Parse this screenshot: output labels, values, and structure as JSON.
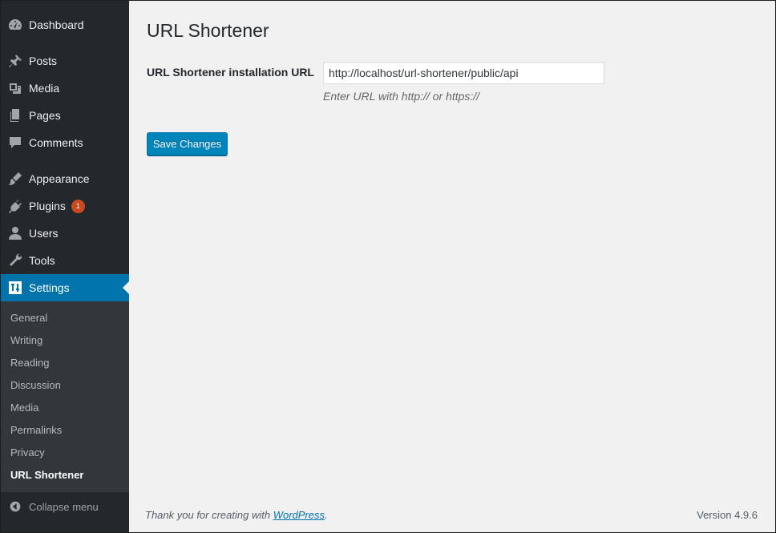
{
  "sidebar": {
    "items": [
      {
        "label": "Dashboard",
        "icon": "dashboard-icon"
      },
      {
        "label": "Posts",
        "icon": "pin-icon"
      },
      {
        "label": "Media",
        "icon": "media-icon"
      },
      {
        "label": "Pages",
        "icon": "pages-icon"
      },
      {
        "label": "Comments",
        "icon": "comment-icon"
      },
      {
        "label": "Appearance",
        "icon": "brush-icon"
      },
      {
        "label": "Plugins",
        "icon": "plug-icon",
        "badge": "1"
      },
      {
        "label": "Users",
        "icon": "user-icon"
      },
      {
        "label": "Tools",
        "icon": "wrench-icon"
      },
      {
        "label": "Settings",
        "icon": "settings-icon"
      }
    ],
    "submenu": [
      "General",
      "Writing",
      "Reading",
      "Discussion",
      "Media",
      "Permalinks",
      "Privacy",
      "URL Shortener"
    ],
    "collapse_label": "Collapse menu"
  },
  "main": {
    "title": "URL Shortener",
    "field_label": "URL Shortener installation URL",
    "url_value": "http://localhost/url-shortener/public/api",
    "description": "Enter URL with http:// or https://",
    "save_label": "Save Changes"
  },
  "footer": {
    "thanks_prefix": "Thank you for creating with ",
    "thanks_link": "WordPress",
    "thanks_suffix": ".",
    "version": "Version 4.9.6"
  },
  "colors": {
    "sidebar_bg": "#23282d",
    "submenu_bg": "#32373c",
    "accent": "#0073aa",
    "button": "#0085ba",
    "badge": "#ca4a1f",
    "page_bg": "#f1f1f1"
  }
}
